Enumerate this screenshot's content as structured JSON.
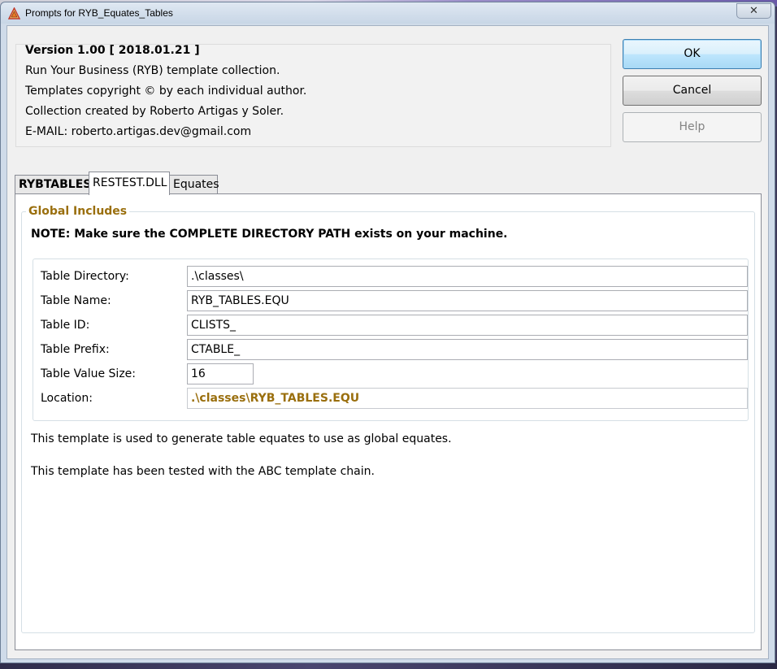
{
  "window": {
    "title": "Prompts for RYB_Equates_Tables",
    "close_glyph": "✕"
  },
  "info": {
    "version": "Version 1.00 [ 2018.01.21 ]",
    "line1": "Run Your Business (RYB) template collection.",
    "line2": "Templates copyright © by each individual author.",
    "line3": "Collection created by Roberto Artigas y Soler.",
    "line4": "E-MAIL: roberto.artigas.dev@gmail.com"
  },
  "buttons": {
    "ok": "OK",
    "cancel": "Cancel",
    "help": "Help"
  },
  "tabs": [
    {
      "label": "RYBTABLES",
      "active": false,
      "bold": true
    },
    {
      "label": "RESTEST.DLL",
      "active": true,
      "bold": false
    },
    {
      "label": "Equates",
      "active": false,
      "bold": false
    }
  ],
  "group": {
    "legend": "Global Includes",
    "note": "NOTE: Make sure the COMPLETE DIRECTORY PATH exists on your machine."
  },
  "fields": {
    "table_directory": {
      "label": "Table Directory:",
      "value": ".\\classes\\"
    },
    "table_name": {
      "label": "Table Name:",
      "value": "RYB_TABLES.EQU"
    },
    "table_id": {
      "label": "Table ID:",
      "value": "CLISTS_"
    },
    "table_prefix": {
      "label": "Table Prefix:",
      "value": "CTABLE_"
    },
    "table_value_size": {
      "label": "Table Value Size:",
      "value": "16"
    },
    "location": {
      "label": "Location:",
      "value": ".\\classes\\RYB_TABLES.EQU"
    }
  },
  "description": {
    "line1": "This template is used to generate table equates to use as global equates.",
    "line2": "This template has been tested with the ABC template chain."
  },
  "colors": {
    "accent_gold": "#9a6f0e",
    "default_button_border": "#3c7fb1"
  },
  "icons": {
    "app": "clarion-triangle-icon",
    "close": "close-icon"
  }
}
